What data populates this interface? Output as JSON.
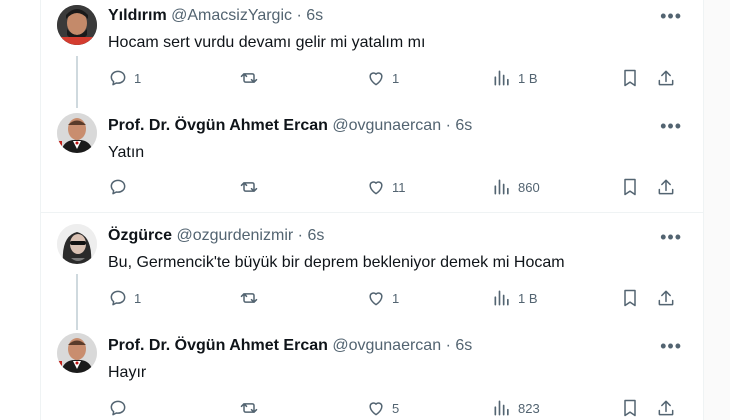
{
  "more_glyph": "•••",
  "posts": [
    {
      "name": "Yıldırım",
      "handle": "@AmacsizYargic",
      "sep": "·",
      "time": "6s",
      "text": "Hocam sert vurdu devamı gelir mi yatalım mı",
      "replies": "1",
      "reposts": "",
      "likes": "1",
      "views": "1 B"
    },
    {
      "name": "Prof. Dr. Övgün Ahmet Ercan",
      "handle": "@ovgunaercan",
      "sep": "·",
      "time": "6s",
      "text": "Yatın",
      "replies": "",
      "reposts": "",
      "likes": "11",
      "views": "860"
    },
    {
      "name": "Özgürce",
      "handle": "@ozgurdenizmir",
      "sep": "·",
      "time": "6s",
      "text": "Bu, Germencik'te büyük bir deprem bekleniyor demek mi Hocam",
      "replies": "1",
      "reposts": "",
      "likes": "1",
      "views": "1 B"
    },
    {
      "name": "Prof. Dr. Övgün Ahmet Ercan",
      "handle": "@ovgunaercan",
      "sep": "·",
      "time": "6s",
      "text": "Hayır",
      "replies": "",
      "reposts": "",
      "likes": "5",
      "views": "823"
    }
  ],
  "icons": {
    "reply": "reply-icon",
    "repost": "repost-icon",
    "like": "like-icon",
    "views": "views-icon",
    "bookmark": "bookmark-icon",
    "share": "share-icon"
  },
  "colors": {
    "text": "#0f1419",
    "secondary": "#536471",
    "thread_line": "#cfd9de",
    "divider": "#eff3f4"
  }
}
